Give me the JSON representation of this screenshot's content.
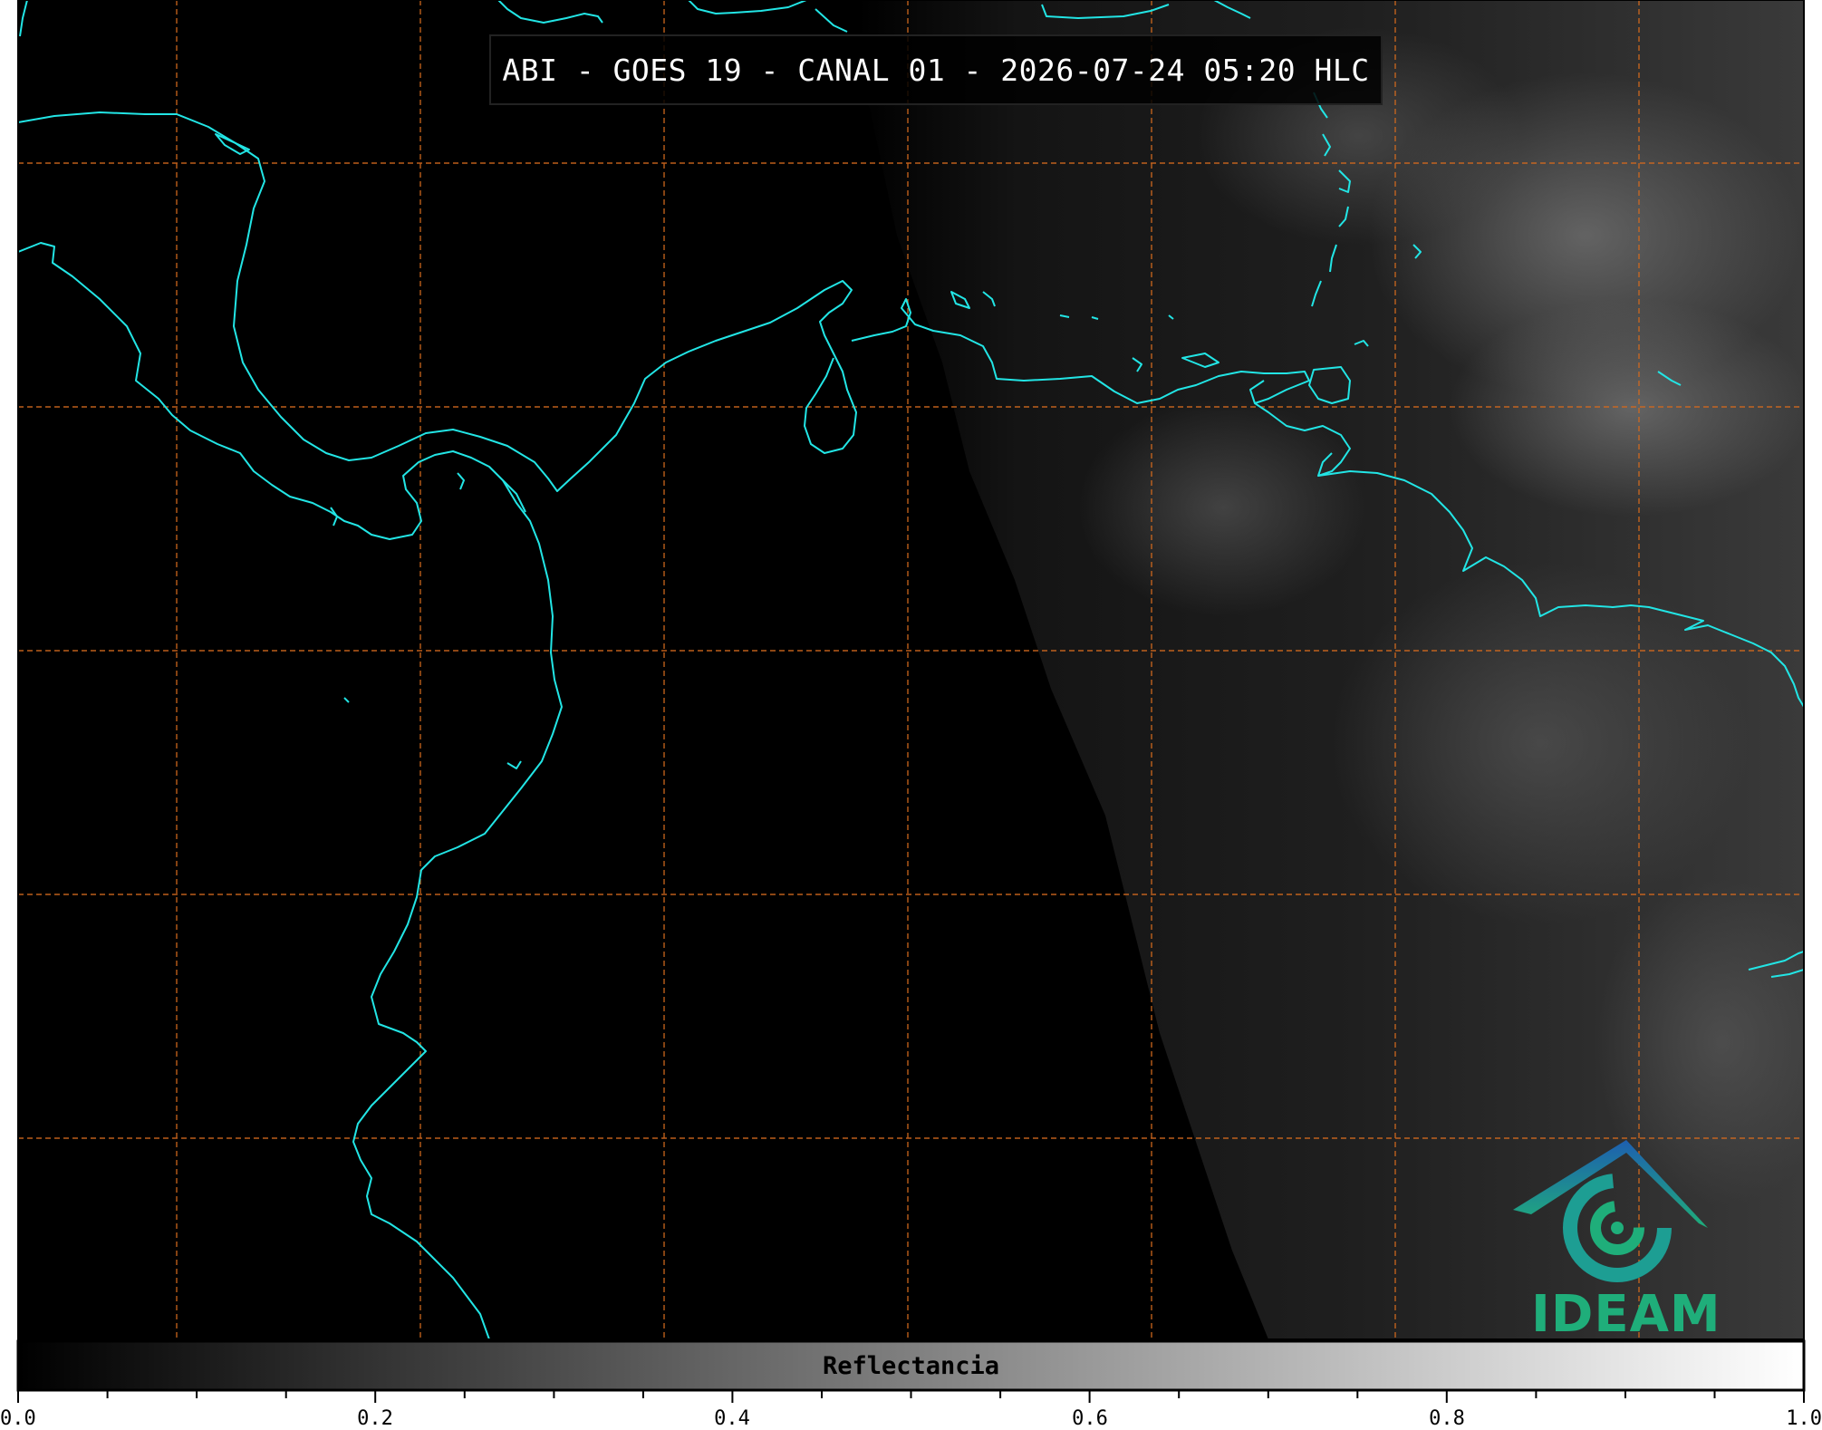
{
  "title": "ABI - GOES 19 - CANAL 01 - 2026-07-24 05:20 HLC",
  "colorbar": {
    "label": "Reflectancia",
    "ticks": [
      "0.0",
      "0.2",
      "0.4",
      "0.6",
      "0.8",
      "1.0"
    ],
    "min": 0.0,
    "max": 1.0,
    "start_color": "#000000",
    "end_color": "#ffffff"
  },
  "logo": {
    "text": "IDEAM",
    "color": "#1fae7a"
  },
  "colors": {
    "coastline": "#22e5e5",
    "grid": "#d2691e",
    "frame": "#000000"
  }
}
